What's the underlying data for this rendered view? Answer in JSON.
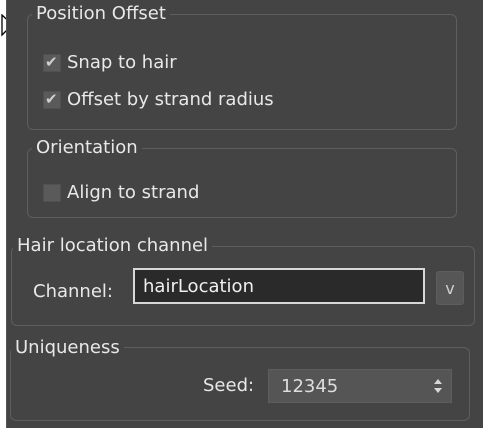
{
  "groups": {
    "position_offset": {
      "legend": "Position Offset",
      "snap_to_hair": {
        "label": "Snap to hair",
        "checked": true
      },
      "offset_by_strand_radius": {
        "label": "Offset by strand radius",
        "checked": true
      }
    },
    "orientation": {
      "legend": "Orientation",
      "align_to_strand": {
        "label": "Align to strand",
        "checked": false
      }
    },
    "hair_location_channel": {
      "legend": "Hair location channel",
      "channel_label": "Channel:",
      "channel_value": "hairLocation",
      "dropdown_label": "v"
    },
    "uniqueness": {
      "legend": "Uniqueness",
      "seed_label": "Seed:",
      "seed_value": "12345"
    }
  },
  "icons": {
    "cursor": "mouse-pointer-icon",
    "check": "checkmark-icon",
    "spinner": "up-down-arrows-icon"
  },
  "colors": {
    "panel_background": "#444444",
    "group_border": "#5e5e5e",
    "input_border_focused": "#d8d8d8",
    "text": "#e8e8e8"
  }
}
